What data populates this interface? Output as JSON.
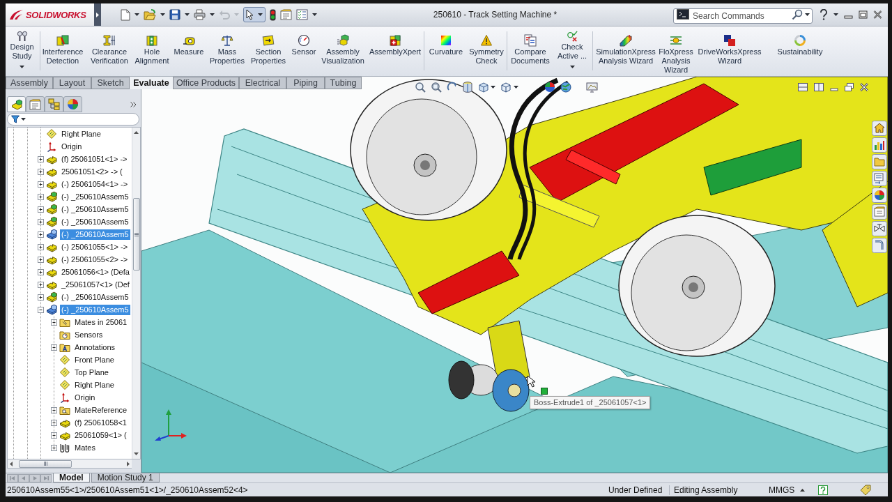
{
  "title_bar": {
    "logo": "SOLIDWORKS",
    "title": "250610 - Track Setting Machine *",
    "search": {
      "placeholder": "Search Commands"
    }
  },
  "quick_access": {
    "undo": {
      "disabled": true
    },
    "select": {
      "selected": true
    }
  },
  "ribbon": {
    "groups": [
      {
        "buttons": [
          {
            "label": "Design\nStudy",
            "kind": "split"
          }
        ]
      },
      {
        "buttons": [
          {
            "label": "Interference\nDetection",
            "kind": "plain"
          },
          {
            "label": "Clearance\nVerification",
            "kind": "plain"
          },
          {
            "label": "Hole\nAlignment",
            "kind": "plain"
          },
          {
            "label": "Measure",
            "kind": "plain"
          },
          {
            "label": "Mass\nProperties",
            "kind": "plain"
          },
          {
            "label": "Section\nProperties",
            "kind": "plain"
          },
          {
            "label": "Sensor",
            "kind": "plain"
          },
          {
            "label": "Assembly\nVisualization",
            "kind": "plain"
          },
          {
            "label": "AssemblyXpert",
            "kind": "plain"
          }
        ]
      },
      {
        "buttons": [
          {
            "label": "Curvature",
            "kind": "plain"
          },
          {
            "label": "Symmetry\nCheck",
            "kind": "plain"
          }
        ]
      },
      {
        "buttons": [
          {
            "label": "Compare\nDocuments",
            "kind": "plain"
          },
          {
            "label": "Check\nActive ...",
            "kind": "split"
          }
        ]
      },
      {
        "buttons": [
          {
            "label": "SimulationXpress\nAnalysis Wizard",
            "kind": "plain"
          },
          {
            "label": "FloXpress\nAnalysis\nWizard",
            "kind": "plain"
          },
          {
            "label": "DriveWorksXpress\nWizard",
            "kind": "plain"
          },
          {
            "label": "Sustainability",
            "kind": "plain"
          }
        ]
      }
    ]
  },
  "command_tabs": [
    {
      "label": "Assembly",
      "selected": false
    },
    {
      "label": "Layout",
      "selected": false
    },
    {
      "label": "Sketch",
      "selected": false
    },
    {
      "label": "Evaluate",
      "selected": true
    },
    {
      "label": "Office Products",
      "selected": false
    },
    {
      "label": "Electrical",
      "selected": false
    },
    {
      "label": "Piping",
      "selected": false
    },
    {
      "label": "Tubing",
      "selected": false
    }
  ],
  "panel_tabs": [
    {
      "selected": true
    },
    {
      "selected": false
    },
    {
      "selected": false
    },
    {
      "selected": false
    }
  ],
  "feature_tree": {
    "items": [
      {
        "label": "Right Plane",
        "kind": "plane",
        "selected": false
      },
      {
        "label": "Origin",
        "kind": "origin",
        "selected": false
      },
      {
        "label": "(f) 25061051<1> ->",
        "kind": "part",
        "expanded": false,
        "selected": false
      },
      {
        "label": "25061051<2> -> (",
        "kind": "part",
        "expanded": false,
        "selected": false
      },
      {
        "label": "(-) 25061054<1> ->",
        "kind": "part",
        "expanded": false,
        "selected": false
      },
      {
        "label": "(-) _250610Assem5",
        "kind": "assembly",
        "expanded": false,
        "selected": false
      },
      {
        "label": "(-) _250610Assem5",
        "kind": "assembly",
        "expanded": false,
        "selected": false
      },
      {
        "label": "(-) _250610Assem5",
        "kind": "assembly",
        "expanded": false,
        "selected": false
      },
      {
        "label": "(-) _250610Assem5",
        "kind": "assembly",
        "expanded": false,
        "selected": true
      },
      {
        "label": "(-) 25061055<1> ->",
        "kind": "part",
        "expanded": false,
        "selected": false
      },
      {
        "label": "(-) 25061055<2> ->",
        "kind": "part",
        "expanded": false,
        "selected": false
      },
      {
        "label": "25061056<1> (Defa",
        "kind": "part",
        "expanded": false,
        "selected": false
      },
      {
        "label": "_25061057<1> (Def",
        "kind": "part",
        "expanded": false,
        "selected": false
      },
      {
        "label": "(-) _250610Assem5",
        "kind": "assembly",
        "expanded": false,
        "selected": false
      },
      {
        "label": "(-) _250610Assem5",
        "kind": "assembly",
        "expanded": true,
        "selected": true,
        "children": [
          {
            "label": "Mates in 25061",
            "kind": "mates_folder",
            "expanded": false,
            "selected": false
          },
          {
            "label": "Sensors",
            "kind": "sensors_folder",
            "selected": false
          },
          {
            "label": "Annotations",
            "kind": "annotations_folder",
            "expanded": false,
            "selected": false
          },
          {
            "label": "Front Plane",
            "kind": "plane",
            "selected": false
          },
          {
            "label": "Top Plane",
            "kind": "plane",
            "selected": false
          },
          {
            "label": "Right Plane",
            "kind": "plane",
            "selected": false
          },
          {
            "label": "Origin",
            "kind": "origin",
            "selected": false
          },
          {
            "label": "MateReference",
            "kind": "mate_reference",
            "expanded": false,
            "selected": false
          },
          {
            "label": "(f) 25061058<1",
            "kind": "part",
            "expanded": false,
            "selected": false
          },
          {
            "label": "25061059<1> (",
            "kind": "part",
            "expanded": false,
            "selected": false
          },
          {
            "label": "Mates",
            "kind": "mates",
            "expanded": false,
            "selected": false
          }
        ]
      }
    ]
  },
  "viewport": {
    "tooltip": "Boss-Extrude1 of _25061057<1>"
  },
  "bottom_tabs": [
    {
      "label": "Model",
      "selected": true
    },
    {
      "label": "Motion Study 1",
      "selected": false
    }
  ],
  "status_bar": {
    "path": "250610Assem55<1>/250610Assem51<1>/_250610Assem52<4>",
    "definition": "Under Defined",
    "mode": "Editing Assembly",
    "units": "MMGS"
  }
}
